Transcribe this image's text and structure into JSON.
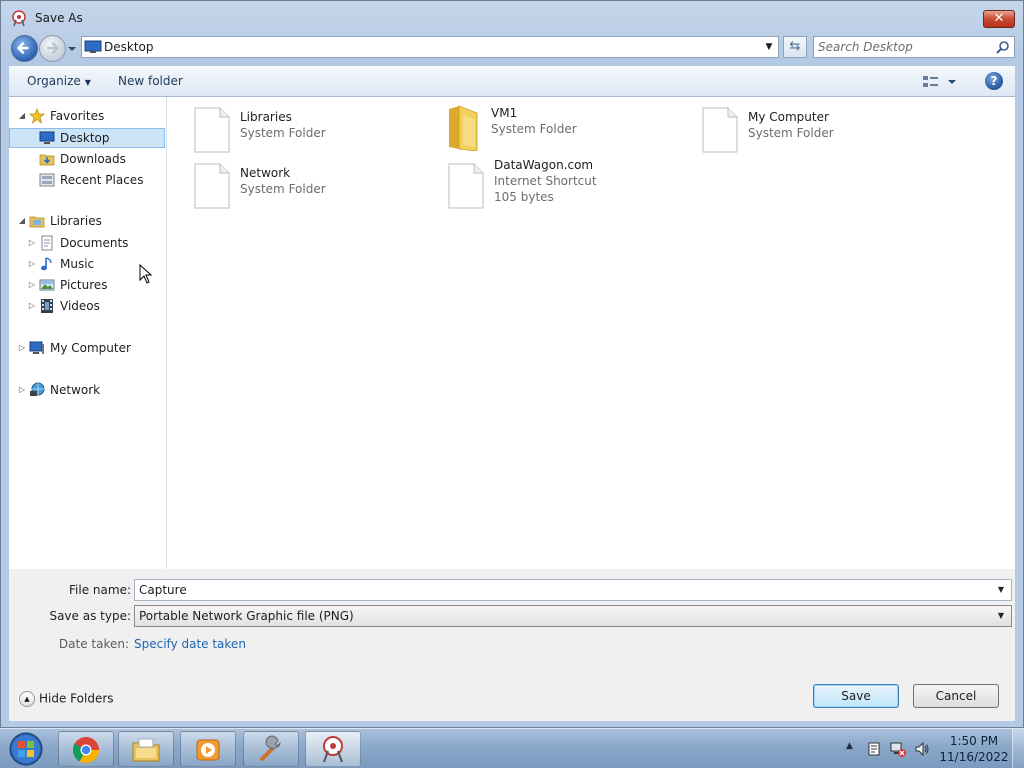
{
  "window": {
    "title": "Save As",
    "close_glyph": "✕"
  },
  "nav": {
    "address": "Desktop",
    "search_placeholder": "Search Desktop",
    "refresh_glyph": "⇆"
  },
  "toolbar": {
    "organize_label": "Organize",
    "new_folder_label": "New folder",
    "help_glyph": "?"
  },
  "tree": {
    "favorites": {
      "label": "Favorites",
      "items": [
        {
          "label": "Desktop",
          "icon": "desktop-icon",
          "selected": true
        },
        {
          "label": "Downloads",
          "icon": "downloads-folder-icon"
        },
        {
          "label": "Recent Places",
          "icon": "recent-places-icon"
        }
      ]
    },
    "libraries": {
      "label": "Libraries",
      "items": [
        {
          "label": "Documents",
          "icon": "documents-icon"
        },
        {
          "label": "Music",
          "icon": "music-icon"
        },
        {
          "label": "Pictures",
          "icon": "pictures-icon"
        },
        {
          "label": "Videos",
          "icon": "videos-icon"
        }
      ]
    },
    "computer": {
      "label": "My Computer"
    },
    "network": {
      "label": "Network"
    }
  },
  "files": [
    {
      "name": "Libraries",
      "type": "System Folder",
      "icon": "blank-file-icon"
    },
    {
      "name": "VM1",
      "type": "System Folder",
      "icon": "yellow-folder-icon"
    },
    {
      "name": "My Computer",
      "type": "System Folder",
      "icon": "blank-file-icon"
    },
    {
      "name": "Network",
      "type": "System Folder",
      "icon": "blank-file-icon"
    },
    {
      "name": "DataWagon.com",
      "type": "Internet Shortcut",
      "size": "105 bytes",
      "icon": "blank-file-icon"
    }
  ],
  "form": {
    "filename_label": "File name:",
    "filename_value": "Capture",
    "savetype_label": "Save as type:",
    "savetype_value": "Portable Network Graphic file (PNG)",
    "date_label": "Date taken:",
    "date_link": "Specify date taken"
  },
  "buttons": {
    "hide_folders": "Hide Folders",
    "save": "Save",
    "cancel": "Cancel"
  },
  "taskbar": {
    "apps": [
      "chrome-icon",
      "file-explorer-icon",
      "media-player-icon",
      "tools-icon",
      "snipping-tool-icon"
    ],
    "clock_time": "1:50 PM",
    "clock_date": "11/16/2022"
  },
  "colors": {
    "accent": "#1f63b5",
    "selection": "#cce4f7",
    "close_red": "#c94a33"
  }
}
